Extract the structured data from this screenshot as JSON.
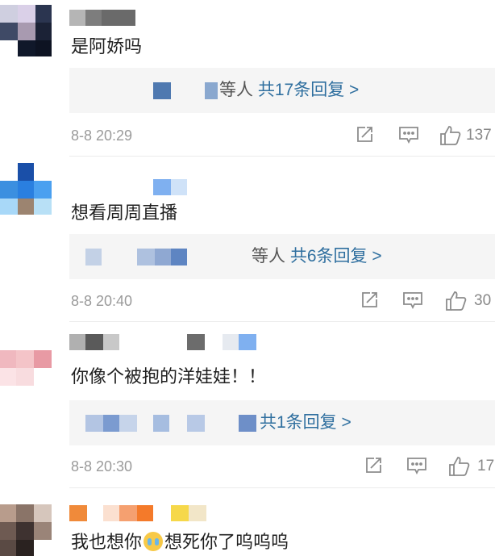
{
  "comments": [
    {
      "text": "是阿娇吗",
      "reply_suffix": "等人",
      "reply_link": "共17条回复 >",
      "timestamp": "8-8 20:29",
      "likes": "137"
    },
    {
      "text": "想看周周直播",
      "reply_suffix": "等人",
      "reply_link": "共6条回复 >",
      "timestamp": "8-8 20:40",
      "likes": "30"
    },
    {
      "text": "你像个被抱的洋娃娃！！",
      "reply_suffix": "",
      "reply_link": "共1条回复 >",
      "timestamp": "8-8 20:30",
      "likes": "17"
    },
    {
      "text_before_emoji": "我也想你",
      "emoji": "crying-face-emoji",
      "text_after_emoji": "想死你了呜呜呜"
    }
  ],
  "icons": {
    "share": "share-icon",
    "comment": "comment-icon",
    "like": "like-icon"
  },
  "colors": {
    "reply_link": "#2f6f9f",
    "meta_text": "#9a9a9a",
    "reply_bg": "#f5f5f5"
  }
}
